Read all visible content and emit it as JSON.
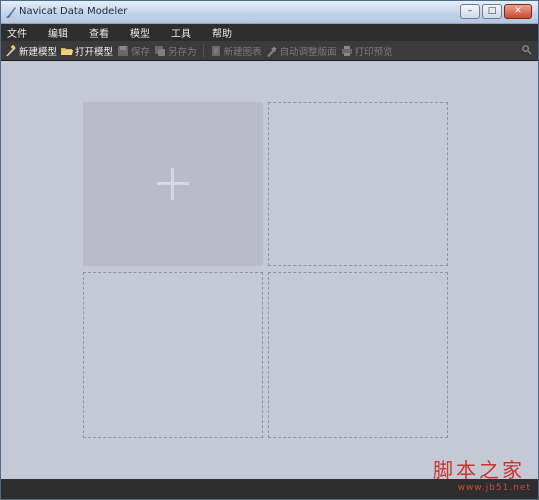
{
  "window": {
    "title": "Navicat Data Modeler"
  },
  "menubar": {
    "items": [
      {
        "id": "file",
        "label": "文件"
      },
      {
        "id": "edit",
        "label": "编辑"
      },
      {
        "id": "view",
        "label": "查看"
      },
      {
        "id": "model",
        "label": "模型"
      },
      {
        "id": "tools",
        "label": "工具"
      },
      {
        "id": "help",
        "label": "帮助"
      }
    ]
  },
  "toolbar": {
    "new_model": {
      "label": "新建模型",
      "icon": "new-model-icon",
      "enabled": true
    },
    "open_model": {
      "label": "打开模型",
      "icon": "folder-icon",
      "enabled": true
    },
    "save": {
      "label": "保存",
      "icon": "save-icon",
      "enabled": false
    },
    "save_as": {
      "label": "另存为",
      "icon": "save-as-icon",
      "enabled": false
    },
    "new_diagram": {
      "label": "新建图表",
      "icon": "new-diagram-icon",
      "enabled": false
    },
    "auto_layout": {
      "label": "自动调整版面",
      "icon": "auto-layout-icon",
      "enabled": false
    },
    "print_preview": {
      "label": "打印预览",
      "icon": "print-preview-icon",
      "enabled": false
    }
  },
  "workspace": {
    "tiles": [
      {
        "kind": "new-model",
        "icon": "plus-icon"
      },
      {
        "kind": "empty"
      },
      {
        "kind": "empty"
      },
      {
        "kind": "empty"
      }
    ]
  },
  "watermark": {
    "brand": "脚本之家",
    "url": "www.jb51.net"
  },
  "colors": {
    "menubar": "#2e2e2e",
    "toolbar": "#3b3b3b",
    "workspace": "#c4c9d5",
    "new_tile": "#b9bcc8"
  }
}
